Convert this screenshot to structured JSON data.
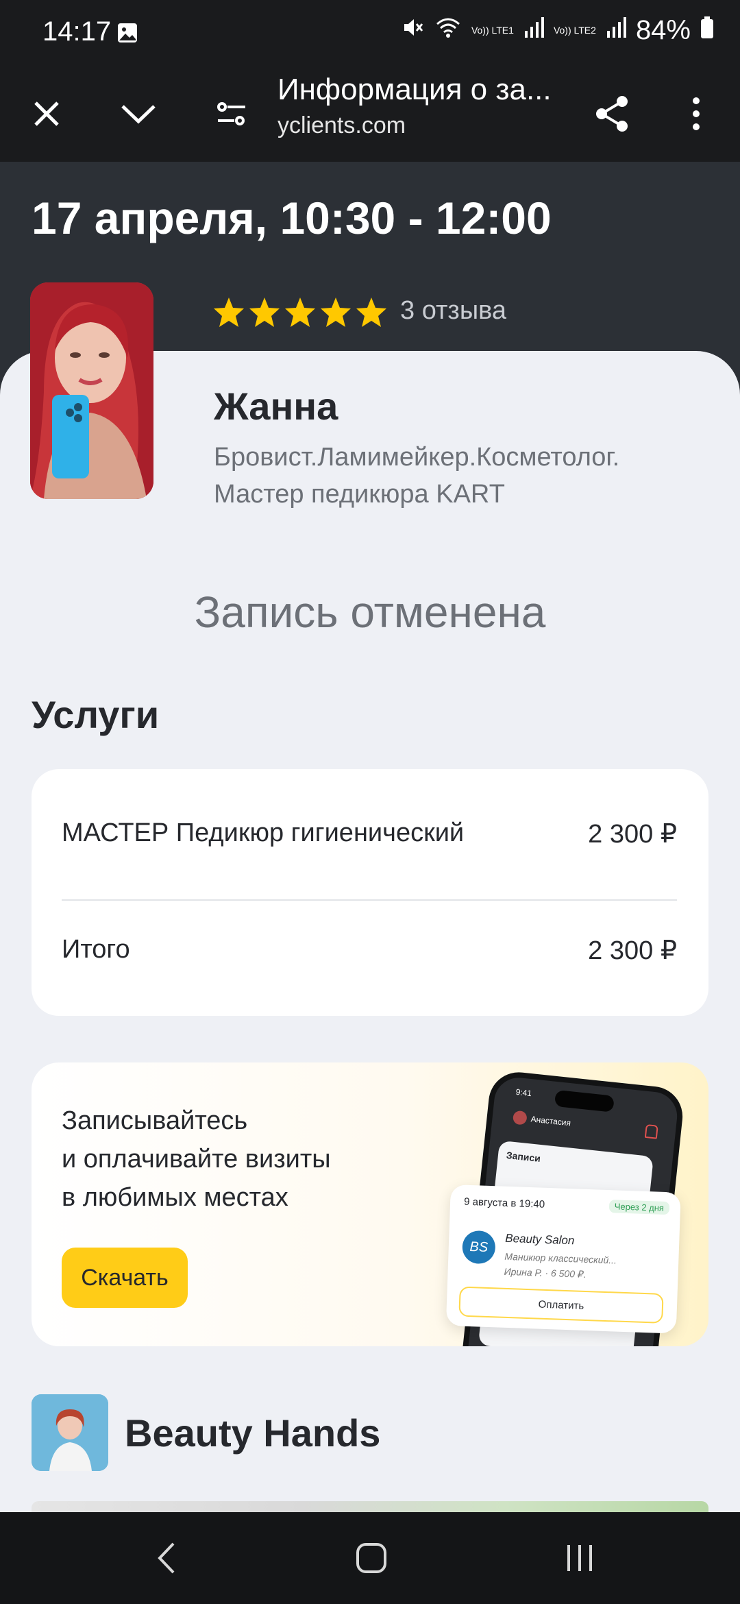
{
  "status_bar": {
    "time": "14:17",
    "battery": "84%",
    "sim1": "Vo)) LTE1",
    "sim2": "Vo)) LTE2",
    "icons": [
      "image-icon",
      "mute-icon",
      "wifi-icon",
      "signal-icon",
      "battery-icon"
    ]
  },
  "browser": {
    "page_title": "Информация о за...",
    "url": "yclients.com",
    "icons": [
      "close-icon",
      "chevron-down-icon",
      "tune-icon",
      "share-icon",
      "more-vert-icon"
    ]
  },
  "appointment": {
    "datetime": "17 апреля, 10:30 - 12:00",
    "rating_stars": 5,
    "reviews": "3 отзыва",
    "master_name": "Жанна",
    "master_role_line1": "Бровист.Ламимейкер.Косметолог.",
    "master_role_line2": "Мастер педикюра KART",
    "status": "Запись отменена"
  },
  "services": {
    "heading": "Услуги",
    "items": [
      {
        "name": "МАСТЕР Педикюр гигиенический",
        "price": "2 300 ₽"
      }
    ],
    "total_label": "Итого",
    "total_price": "2 300 ₽"
  },
  "promo": {
    "line1": "Записывайтесь",
    "line2": "и оплачивайте визиты",
    "line3": "в любимых местах",
    "button": "Скачать",
    "phone": {
      "time": "9:41",
      "user": "Анастасия",
      "section": "Записи",
      "appt_date": "9 августа в 19:40",
      "appt_when": "Через 2 дня",
      "logo": "BS",
      "salon": "Beauty Salon",
      "service": "Маникюр классический...",
      "meta": "Ирина Р. · 6 500 ₽.",
      "pay": "Оплатить"
    }
  },
  "salon": {
    "name": "Beauty Hands"
  },
  "colors": {
    "accent": "#ffcc17",
    "star": "#ffc800",
    "dark": "#2c3036",
    "background": "#eef0f5"
  }
}
